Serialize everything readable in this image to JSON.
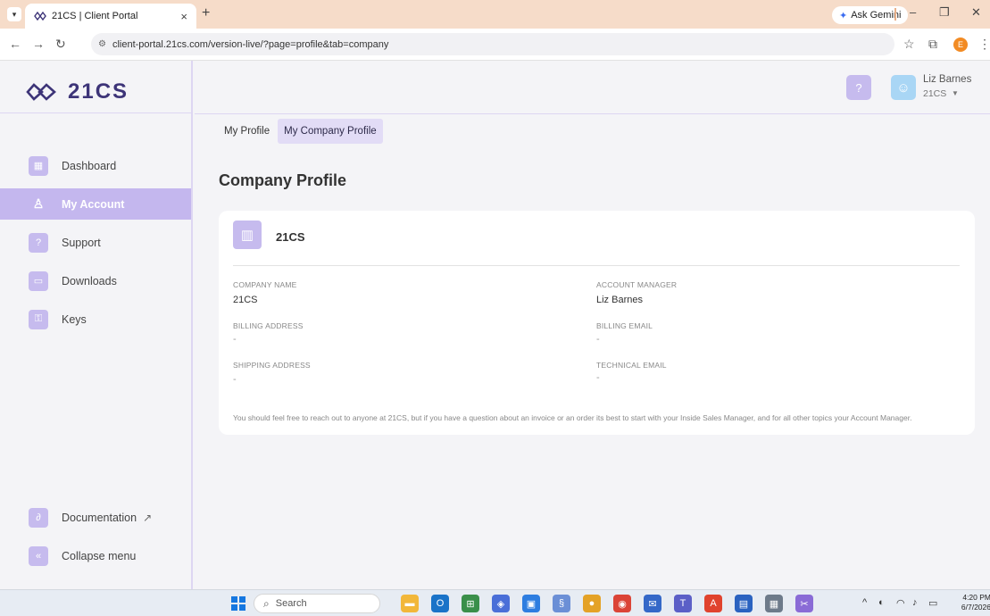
{
  "browser": {
    "tab_title": "21CS | Client Portal",
    "tab_close": "×",
    "new_tab": "+",
    "gemini_label": "Ask Gemini",
    "url": "client-portal.21cs.com/version-live/?page=profile&tab=company",
    "profile_initial": "E"
  },
  "app": {
    "logo_text": "21CS",
    "sidebar": {
      "items": [
        {
          "label": "Dashboard",
          "icon": "dashboard-icon"
        },
        {
          "label": "My Account",
          "icon": "user-icon",
          "active": true
        },
        {
          "label": "Support",
          "icon": "support-icon"
        },
        {
          "label": "Downloads",
          "icon": "folder-icon"
        },
        {
          "label": "Keys",
          "icon": "key-icon"
        }
      ],
      "bottom": [
        {
          "label": "Documentation",
          "icon": "documentation-icon"
        },
        {
          "label": "Collapse menu",
          "icon": "collapse-icon"
        }
      ]
    },
    "header": {
      "user_name": "Liz Barnes",
      "user_company": "21CS"
    },
    "tabs": [
      {
        "label": "My Profile",
        "active": false
      },
      {
        "label": "My Company Profile",
        "active": true
      }
    ],
    "page_title": "Company Profile",
    "card": {
      "company": "21CS",
      "fields": {
        "company_name_label": "COMPANY NAME",
        "company_name_value": "21CS",
        "account_manager_label": "ACCOUNT MANAGER",
        "account_manager_value": "Liz Barnes",
        "billing_address_label": "BILLING ADDRESS",
        "billing_address_value": "-",
        "billing_email_label": "BILLING EMAIL",
        "billing_email_value": "-",
        "shipping_address_label": "SHIPPING ADDRESS",
        "shipping_address_value": "-",
        "technical_email_label": "TECHNICAL EMAIL",
        "technical_email_value": "-"
      },
      "note": "You should feel free to reach out to anyone at 21CS, but if you have a question about an invoice or an order its best to start with your Inside Sales Manager, and for all other topics your Account Manager."
    },
    "colors": {
      "accent": "#c4b7ee",
      "brand": "#3d3478",
      "avatar": "#a9d6f5"
    }
  },
  "taskbar": {
    "search_placeholder": "Search",
    "time": "4:20 PM",
    "date": "6/7/2026"
  }
}
